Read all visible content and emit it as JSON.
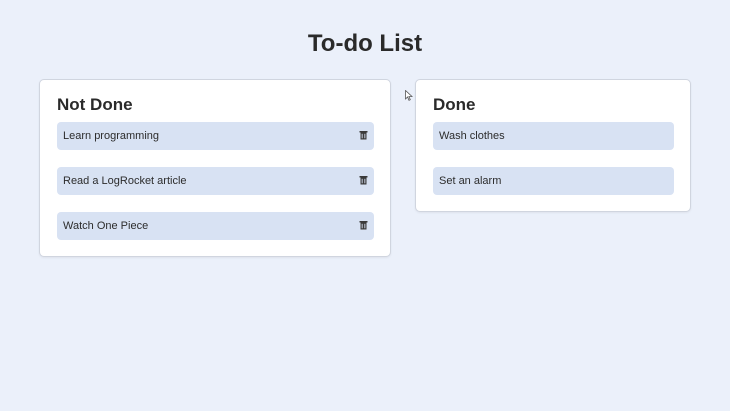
{
  "app": {
    "title": "To-do List"
  },
  "columns": {
    "not_done": {
      "heading": "Not Done",
      "items": [
        {
          "label": "Learn programming",
          "icon": "trash-icon"
        },
        {
          "label": "Read a LogRocket article",
          "icon": "trash-icon"
        },
        {
          "label": "Watch One Piece",
          "icon": "trash-icon"
        }
      ]
    },
    "done": {
      "heading": "Done",
      "items": [
        {
          "label": "Wash clothes"
        },
        {
          "label": "Set an alarm"
        }
      ]
    }
  },
  "colors": {
    "background": "#ebf0fa",
    "card": "#ffffff",
    "task": "#d8e2f3",
    "text": "#2a2a2a"
  }
}
